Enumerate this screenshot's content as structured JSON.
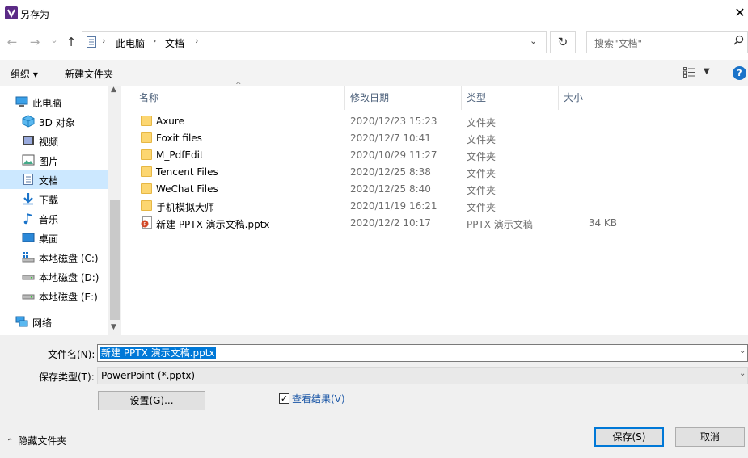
{
  "window": {
    "title": "另存为",
    "close_glyph": "✕"
  },
  "nav": {
    "back_glyph": "←",
    "forward_glyph": "→",
    "recent_glyph": "⌄",
    "up_glyph": "↑",
    "breadcrumb": [
      "此电脑",
      "文档"
    ],
    "search_placeholder": "搜索\"文档\""
  },
  "toolbar": {
    "organize_label": "组织 ▾",
    "new_folder_label": "新建文件夹",
    "help_label": "?"
  },
  "sidebar": {
    "items": [
      {
        "label": "此电脑",
        "icon": "pc-icon",
        "selected": false
      },
      {
        "label": "3D 对象",
        "icon": "cube-icon",
        "selected": false
      },
      {
        "label": "视频",
        "icon": "video-icon",
        "selected": false
      },
      {
        "label": "图片",
        "icon": "picture-icon",
        "selected": false
      },
      {
        "label": "文档",
        "icon": "document-icon",
        "selected": true
      },
      {
        "label": "下载",
        "icon": "download-icon",
        "selected": false
      },
      {
        "label": "音乐",
        "icon": "music-icon",
        "selected": false
      },
      {
        "label": "桌面",
        "icon": "desktop-icon",
        "selected": false
      },
      {
        "label": "本地磁盘 (C:)",
        "icon": "drive-c-icon",
        "selected": false
      },
      {
        "label": "本地磁盘 (D:)",
        "icon": "drive-icon",
        "selected": false
      },
      {
        "label": "本地磁盘 (E:)",
        "icon": "drive-icon",
        "selected": false
      },
      {
        "label": "网络",
        "icon": "network-icon",
        "selected": false
      }
    ]
  },
  "columns": {
    "name": "名称",
    "modified": "修改日期",
    "type": "类型",
    "size": "大小"
  },
  "files": [
    {
      "name": "Axure",
      "modified": "2020/12/23 15:23",
      "type": "文件夹",
      "size": "",
      "kind": "folder"
    },
    {
      "name": "Foxit files",
      "modified": "2020/12/7 10:41",
      "type": "文件夹",
      "size": "",
      "kind": "folder"
    },
    {
      "name": "M_PdfEdit",
      "modified": "2020/10/29 11:27",
      "type": "文件夹",
      "size": "",
      "kind": "folder"
    },
    {
      "name": "Tencent Files",
      "modified": "2020/12/25 8:38",
      "type": "文件夹",
      "size": "",
      "kind": "folder"
    },
    {
      "name": "WeChat Files",
      "modified": "2020/12/25 8:40",
      "type": "文件夹",
      "size": "",
      "kind": "folder"
    },
    {
      "name": "手机模拟大师",
      "modified": "2020/11/19 16:21",
      "type": "文件夹",
      "size": "",
      "kind": "folder"
    },
    {
      "name": "新建 PPTX 演示文稿.pptx",
      "modified": "2020/12/2 10:17",
      "type": "PPTX 演示文稿",
      "size": "34 KB",
      "kind": "pptx"
    }
  ],
  "form": {
    "filename_label": "文件名(N):",
    "filename_value": "新建 PPTX 演示文稿.pptx",
    "filetype_label": "保存类型(T):",
    "filetype_value": "PowerPoint (*.pptx)",
    "settings_label": "设置(G)...",
    "view_result_label": "查看结果(V)",
    "view_result_checked": true
  },
  "footer": {
    "hide_folders_label": "隐藏文件夹",
    "save_label": "保存(S)",
    "cancel_label": "取消"
  },
  "colors": {
    "accent": "#0078d7",
    "selected_bg": "#cce8ff",
    "folder": "#fcd671",
    "link": "#1a56a6"
  }
}
